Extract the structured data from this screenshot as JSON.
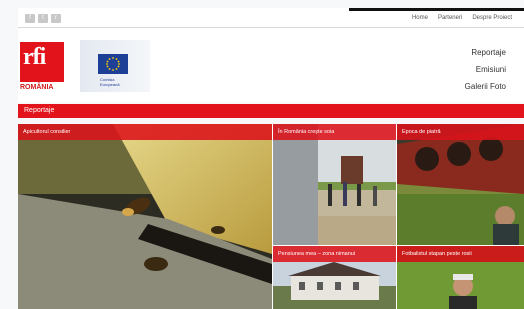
{
  "social": {
    "icons": [
      "facebook-icon",
      "twitter-icon",
      "rss-icon"
    ]
  },
  "topnav": {
    "home": "Home",
    "partners": "Parteneri",
    "about": "Despre Proiect"
  },
  "brand": {
    "logo_text": "rfi",
    "country": "ROMÂNIA",
    "eu_caption_1": "Comisia",
    "eu_caption_2": "Europeană"
  },
  "mainnav": {
    "items": [
      "Reportaje",
      "Emisiuni",
      "Galerii Foto"
    ]
  },
  "section": {
    "label": "Reportaje"
  },
  "tiles": [
    {
      "caption": "Apicultorul consilier"
    },
    {
      "caption": "În România creşte soia"
    },
    {
      "caption": "Epoca de piatră"
    },
    {
      "caption": "Pensiunea mea – zona nimanui"
    },
    {
      "caption": "Fotbalistul stapan peste rosii"
    }
  ],
  "colors": {
    "accent": "#e3131b",
    "eu_blue": "#1e3f96"
  }
}
